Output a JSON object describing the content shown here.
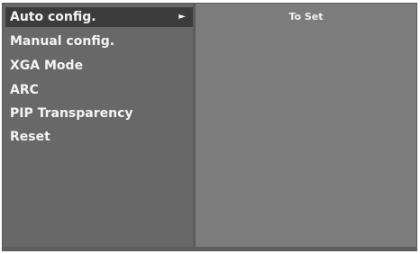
{
  "menu": {
    "items": [
      {
        "label": "Auto config.",
        "selected": true,
        "submenu_arrow": "►"
      },
      {
        "label": "Manual config."
      },
      {
        "label": "XGA Mode"
      },
      {
        "label": "ARC"
      },
      {
        "label": "PIP Transparency"
      },
      {
        "label": "Reset"
      }
    ]
  },
  "detail": {
    "header": "To Set"
  },
  "colors": {
    "menu_background": "#686868",
    "selected_background": "#3c3c3c",
    "detail_background": "#7c7c7c",
    "text": "#f4f4f4"
  },
  "icons": {
    "submenu": "right-triangle-icon"
  }
}
